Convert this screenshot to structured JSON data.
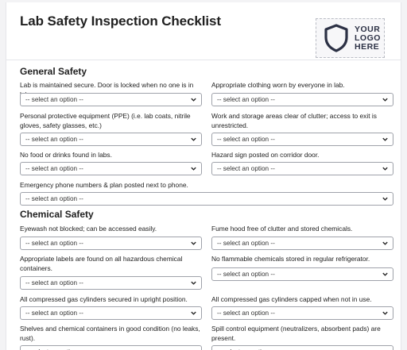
{
  "form": {
    "title": "Lab Safety Inspection Checklist",
    "logo": {
      "icon": "shield-icon",
      "lines": [
        "YOUR",
        "LOGO",
        "HERE"
      ]
    },
    "placeholder": "-- select an option --",
    "sections": [
      {
        "heading": "General Safety",
        "questions": [
          "Lab is maintained secure. Door is locked when no one is in lab.",
          "Appropriate clothing worn by everyone in lab.",
          "Personal protective equipment (PPE) (i.e. lab coats, nitrile gloves, safety glasses, etc.)",
          "Work and storage areas clear of clutter; access to exit is unrestricted.",
          "No food or drinks found in labs.",
          "Hazard sign posted on corridor door.",
          "Emergency phone numbers & plan posted next to phone."
        ]
      },
      {
        "heading": "Chemical Safety",
        "questions": [
          "Eyewash not blocked; can be accessed easily.",
          "Fume hood free of clutter and stored chemicals.",
          "Appropriate labels are found on all hazardous chemical containers.",
          "No flammable chemicals stored in regular refrigerator.",
          "All compressed gas cylinders secured in upright position.",
          "All compressed gas cylinders capped when not in use.",
          "Shelves and chemical containers in good condition (no leaks, rust).",
          "Spill control equipment (neutralizers, absorbent pads) are present."
        ]
      }
    ]
  },
  "colors": {
    "logo_ink": "#2c3145",
    "border": "#9fa2aa"
  }
}
